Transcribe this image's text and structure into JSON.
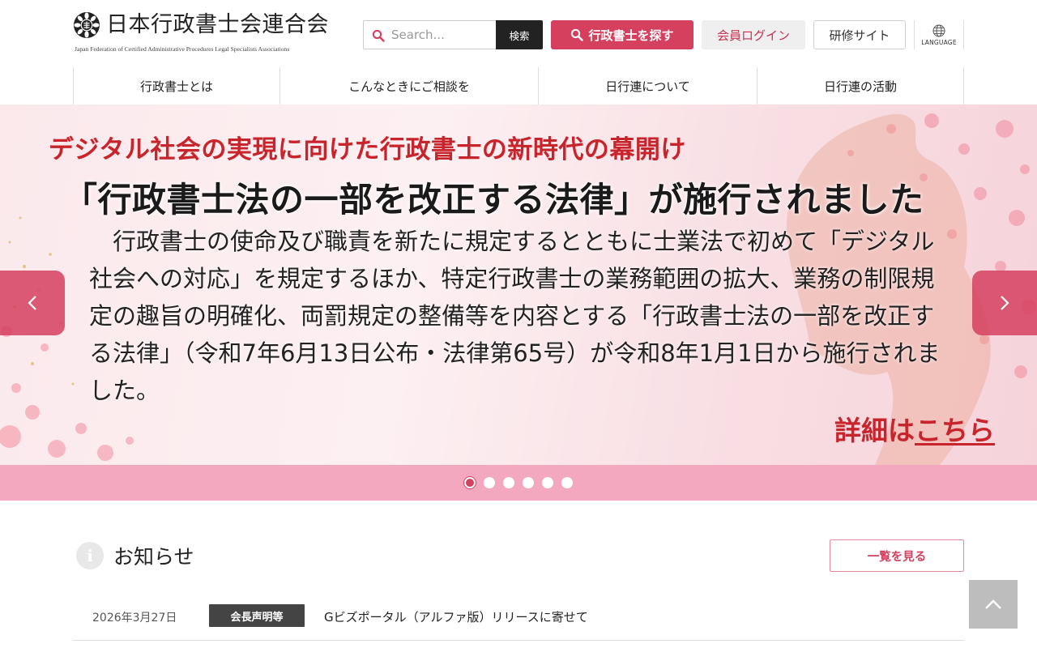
{
  "header": {
    "logo_title": "日本行政書士会連合会",
    "logo_subtitle": "Japan Federation of Certified Administrative Procedures Legal Specialists Associations",
    "search": {
      "placeholder": "Search...",
      "button_label": "検索",
      "icon": "search-icon"
    },
    "find_button_label": "行政書士を探す",
    "login_button_label": "会員ログイン",
    "training_button_label": "研修サイト",
    "language_label": "LANGUAGE",
    "language_icon": "globe-icon"
  },
  "nav": {
    "items": [
      {
        "label": "行政書士とは"
      },
      {
        "label": "こんなときにご相談を"
      },
      {
        "label": "日行連について"
      },
      {
        "label": "日行連の活動"
      }
    ]
  },
  "hero": {
    "headline": "デジタル社会の実現に向けた行政書士の新時代の幕開け",
    "law_title": "「行政書士法の一部を改正する法律」が施行されました",
    "body": "　行政書士の使命及び職責を新たに規定するとともに士業法で初めて「デジタル社会への対応」を規定するほか、特定行政書士の業務範囲の拡大、業務の制限規定の趣旨の明確化、両罰規定の整備等を内容とする「行政書士法の一部を改正する法律」（令和7年6月13日公布・法律第65号）が令和8年1月1日から施行されました。",
    "more_prefix": "詳細は",
    "more_link": "こちら",
    "slide_count": 6,
    "active_slide": 1
  },
  "news": {
    "title": "お知らせ",
    "view_all_label": "一覧を見る",
    "items": [
      {
        "date": "2026年3月27日",
        "category": "会長声明等",
        "text": "Gビズポータル（アルファ版）リリースに寄せて"
      }
    ]
  },
  "colors": {
    "accent": "#d5405f",
    "hero_red": "#c8242c",
    "dots_bar": "#f4a8c0"
  }
}
